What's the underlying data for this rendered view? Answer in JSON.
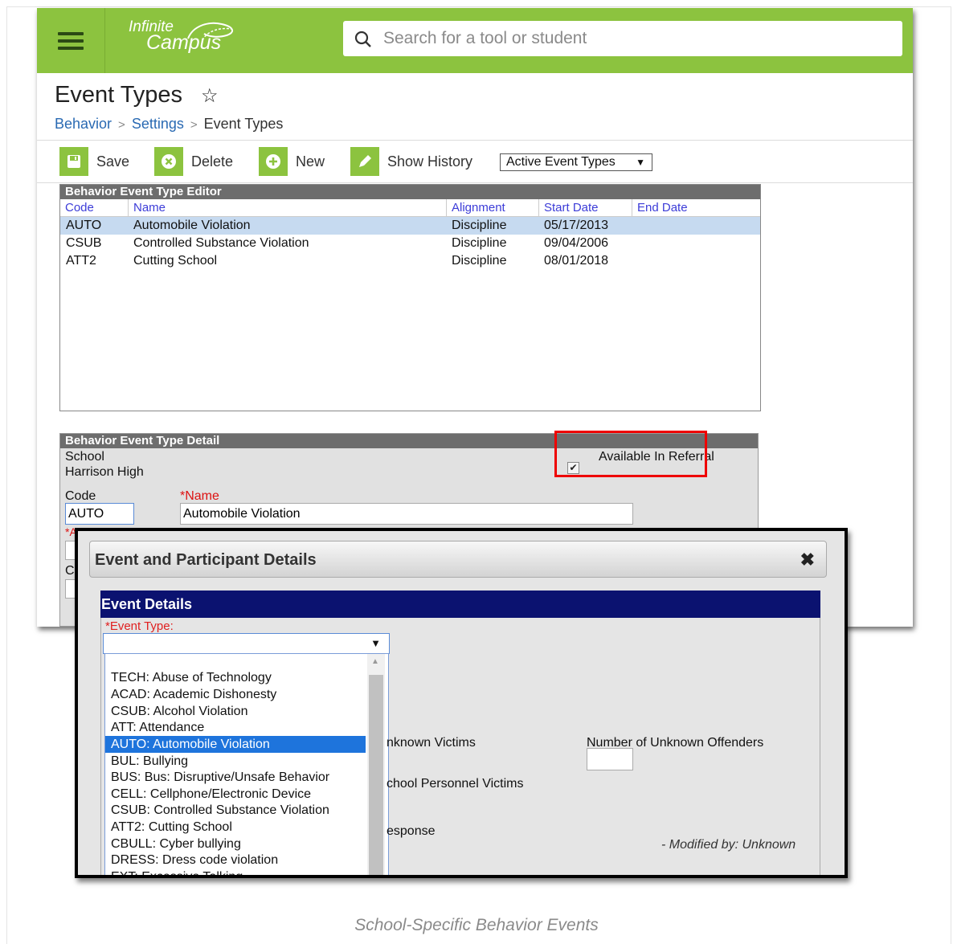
{
  "header": {
    "logo_line1": "Infinite",
    "logo_line2": "Campus",
    "search_placeholder": "Search for a tool or student"
  },
  "page": {
    "title": "Event Types",
    "breadcrumb": [
      "Behavior",
      "Settings",
      "Event Types"
    ]
  },
  "toolbar": {
    "save": "Save",
    "delete": "Delete",
    "new": "New",
    "history": "Show History",
    "filter_selected": "Active Event Types"
  },
  "editor": {
    "title": "Behavior Event Type Editor",
    "columns": [
      "Code",
      "Name",
      "Alignment",
      "Start Date",
      "End Date"
    ],
    "rows": [
      {
        "code": "AUTO",
        "name": "Automobile Violation",
        "alignment": "Discipline",
        "start": "05/17/2013",
        "end": ""
      },
      {
        "code": "CSUB",
        "name": "Controlled Substance Violation",
        "alignment": "Discipline",
        "start": "09/04/2006",
        "end": ""
      },
      {
        "code": "ATT2",
        "name": "Cutting School",
        "alignment": "Discipline",
        "start": "08/01/2018",
        "end": ""
      }
    ]
  },
  "detail": {
    "title": "Behavior Event Type Detail",
    "school_label": "School",
    "school_value": "Harrison High",
    "referral_label": "Available In Referral",
    "referral_checked": true,
    "code_label": "Code",
    "code_value": "AUTO",
    "name_label": "*Name",
    "name_value": "Automobile Violation",
    "partial_label_1": "*A",
    "partial_label_2": "C"
  },
  "dialog": {
    "title": "Event and Participant Details",
    "close_icon": "close-icon",
    "section": "Event Details",
    "event_type_label": "*Event Type:",
    "event_type_value": "",
    "options": [
      "TECH: Abuse of Technology",
      "ACAD: Academic Dishonesty",
      "CSUB: Alcohol Violation",
      "ATT: Attendance",
      "AUTO: Automobile Violation",
      "BUL: Bullying",
      "BUS: Bus: Disruptive/Unsafe Behavior",
      "CELL: Cellphone/Electronic Device",
      "CSUB: Controlled Substance Violation",
      "ATT2: Cutting School",
      "CBULL: Cyber bullying",
      "DRESS: Dress code violation",
      "EXT: Excessive Talking"
    ],
    "highlighted_option": "AUTO: Automobile Violation",
    "unknown_victims": "nknown Victims",
    "unknown_offenders": "Number of Unknown Offenders",
    "school_personnel": "chool Personnel Victims",
    "response": "esponse",
    "modified": "- Modified by: Unknown"
  },
  "caption": "School-Specific Behavior Events",
  "colors": {
    "brand_green": "#8cc33f",
    "dialog_header": "#0b1270",
    "highlight": "#1e74dc",
    "referral_box": "#ee0000"
  }
}
